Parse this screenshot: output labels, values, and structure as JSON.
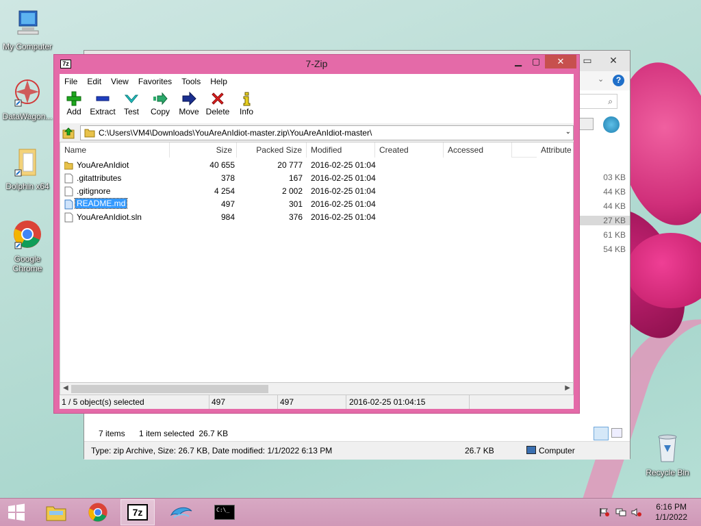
{
  "desktop": {
    "icons": [
      {
        "label": "My Computer"
      },
      {
        "label": "DataWagon..."
      },
      {
        "label": "Dolphin x64"
      },
      {
        "label": "Google Chrome"
      },
      {
        "label": "Recycle Bin"
      }
    ]
  },
  "explorer": {
    "sidebar_sizes": [
      "03 KB",
      "44 KB",
      "44 KB",
      "27 KB",
      "61 KB",
      "54 KB"
    ],
    "items_count": "7 items",
    "selected_info": "1 item selected  26.7 KB",
    "type_info": "Type: zip Archive, Size: 26.7 KB, Date modified: 1/1/2022 6:13 PM",
    "size_info": "26.7 KB",
    "location": "Computer"
  },
  "zip": {
    "title": "7-Zip",
    "app_icon_text": "7z",
    "menu": [
      "File",
      "Edit",
      "View",
      "Favorites",
      "Tools",
      "Help"
    ],
    "toolbar": [
      {
        "label": "Add",
        "icon": "plus-icon"
      },
      {
        "label": "Extract",
        "icon": "minus-icon"
      },
      {
        "label": "Test",
        "icon": "check-icon"
      },
      {
        "label": "Copy",
        "icon": "copy-arrow-icon"
      },
      {
        "label": "Move",
        "icon": "move-arrow-icon"
      },
      {
        "label": "Delete",
        "icon": "delete-x-icon"
      },
      {
        "label": "Info",
        "icon": "info-icon"
      }
    ],
    "address": "C:\\Users\\VM4\\Downloads\\YouAreAnIdiot-master.zip\\YouAreAnIdiot-master\\",
    "columns": [
      "Name",
      "Size",
      "Packed Size",
      "Modified",
      "Created",
      "Accessed",
      "Attribute"
    ],
    "rows": [
      {
        "name": "YouAreAnIdiot",
        "size": "40 655",
        "packed": "20 777",
        "modified": "2016-02-25 01:04",
        "type": "folder"
      },
      {
        "name": ".gitattributes",
        "size": "378",
        "packed": "167",
        "modified": "2016-02-25 01:04",
        "type": "file"
      },
      {
        "name": ".gitignore",
        "size": "4 254",
        "packed": "2 002",
        "modified": "2016-02-25 01:04",
        "type": "file"
      },
      {
        "name": "README.md",
        "size": "497",
        "packed": "301",
        "modified": "2016-02-25 01:04",
        "type": "file",
        "selected": true
      },
      {
        "name": "YouAreAnIdiot.sln",
        "size": "984",
        "packed": "376",
        "modified": "2016-02-25 01:04",
        "type": "file"
      }
    ],
    "status": {
      "selection": "1 / 5 object(s) selected",
      "size": "497",
      "packed": "497",
      "modified": "2016-02-25 01:04:15"
    }
  },
  "taskbar": {
    "clock_time": "6:16 PM",
    "clock_date": "1/1/2022",
    "zip_label": "7z",
    "cmd_label": "C:\\_"
  },
  "colors": {
    "window_frame": "#e46aa8",
    "selection": "#3399ff",
    "close_button": "#c7504e"
  }
}
